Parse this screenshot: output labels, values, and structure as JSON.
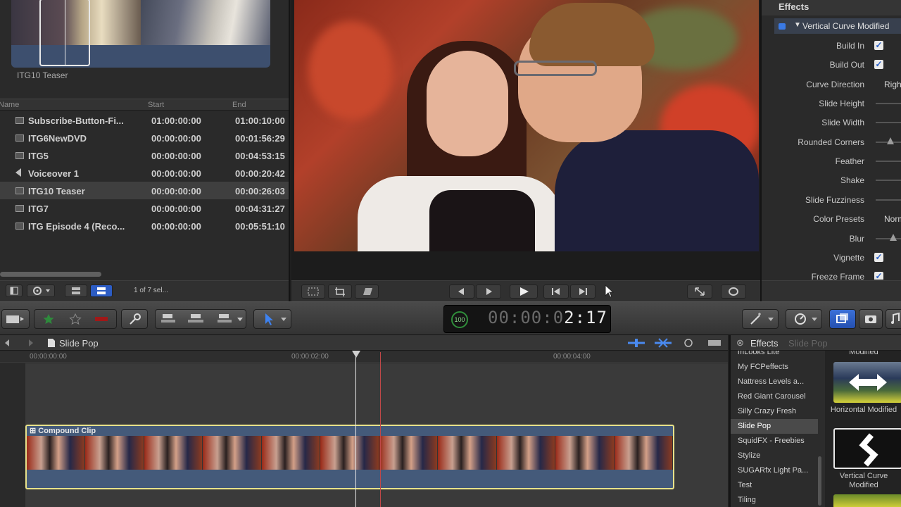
{
  "browser": {
    "clip_caption": "ITG10 Teaser",
    "columns": {
      "name": "Name",
      "start": "Start",
      "end": "End"
    },
    "rows": [
      {
        "name": "Subscribe-Button-Fi...",
        "start": "01:00:00:00",
        "end": "01:00:10:00",
        "icon": "clip-icon"
      },
      {
        "name": "ITG6NewDVD",
        "start": "00:00:00:00",
        "end": "00:01:56:29",
        "icon": "clip-icon"
      },
      {
        "name": "ITG5",
        "start": "00:00:00:00",
        "end": "00:04:53:15",
        "icon": "clip-icon"
      },
      {
        "name": "Voiceover 1",
        "start": "00:00:00:00",
        "end": "00:00:20:42",
        "icon": "audio-icon"
      },
      {
        "name": "ITG10 Teaser",
        "start": "00:00:00:00",
        "end": "00:00:26:03",
        "icon": "clip-icon",
        "selected": true
      },
      {
        "name": "ITG7",
        "start": "00:00:00:00",
        "end": "00:04:31:27",
        "icon": "clip-icon"
      },
      {
        "name": "ITG Episode 4 (Reco...",
        "start": "00:00:00:00",
        "end": "00:05:51:10",
        "icon": "clip-icon"
      }
    ],
    "selection_count": "1 of 7 sel..."
  },
  "inspector": {
    "title": "Effects",
    "effect_name": "Vertical Curve Modified",
    "params": [
      {
        "label": "Build In",
        "type": "check",
        "value": true
      },
      {
        "label": "Build Out",
        "type": "check",
        "value": true
      },
      {
        "label": "Curve Direction",
        "type": "text",
        "value": "Right"
      },
      {
        "label": "Slide Height",
        "type": "slider"
      },
      {
        "label": "Slide Width",
        "type": "slider"
      },
      {
        "label": "Rounded Corners",
        "type": "slider"
      },
      {
        "label": "Feather",
        "type": "slider"
      },
      {
        "label": "Shake",
        "type": "slider"
      },
      {
        "label": "Slide Fuzziness",
        "type": "slider"
      },
      {
        "label": "Color Presets",
        "type": "text",
        "value": "Normal"
      },
      {
        "label": "Blur",
        "type": "slider"
      },
      {
        "label": "Vignette",
        "type": "check",
        "value": true
      },
      {
        "label": "Freeze Frame",
        "type": "check",
        "value": true
      }
    ]
  },
  "toolbar": {
    "timecode_dim": "00:00:0",
    "timecode_bright": "2:17",
    "timecode_badge": "100",
    "accent": "#2f5fc8"
  },
  "timeline": {
    "title": "Slide Pop",
    "ticks": [
      "00:00:00:00",
      "00:00:02:00",
      "00:00:04:00"
    ],
    "clip_label": "Compound Clip"
  },
  "effects_browser": {
    "tab_active": "Effects",
    "tab_inactive": "Slide Pop",
    "categories": [
      "mLooks Lite",
      "My FCPeffects",
      "Nattress Levels a...",
      "Red Giant Carousel",
      "Silly Crazy Fresh",
      "Slide Pop",
      "SquidFX - Freebies",
      "Stylize",
      "SUGARfx Light Pa...",
      "Test",
      "Tiling"
    ],
    "selected_category": "Slide Pop",
    "items": [
      {
        "caption_top": "Modified"
      },
      {
        "caption": "Horizontal Modified"
      },
      {
        "caption": "Vertical Curve Modified"
      }
    ]
  }
}
